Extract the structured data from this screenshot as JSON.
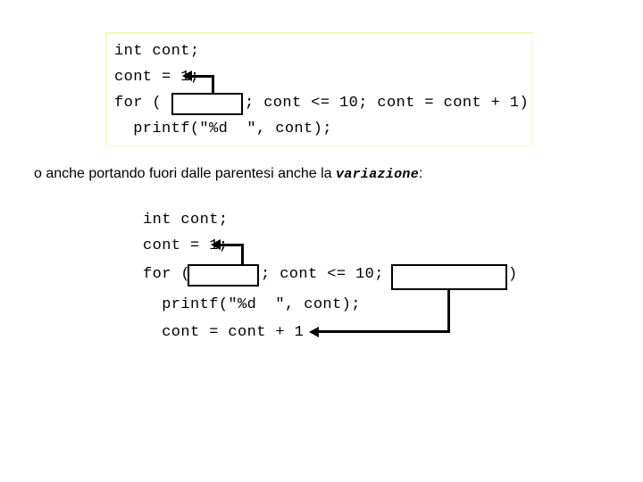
{
  "slide": {
    "background_color": "#ffffff",
    "text_color": "#000000",
    "frame_color": "#f7f7c8"
  },
  "snippet_one": {
    "frame_visible": true,
    "lines": [
      {
        "id": "l1",
        "text": "int cont;"
      },
      {
        "id": "l2",
        "text": "cont = 1;"
      },
      {
        "id": "l3a",
        "text": "for ("
      },
      {
        "id": "l3b",
        "text": "; cont <= 10; cont = cont + 1)"
      },
      {
        "id": "l4",
        "text": "  printf(\"%d  \", cont);"
      }
    ],
    "blank_box": {
      "name": "initialization-blank",
      "value": "",
      "placeholder": ""
    },
    "connector": {
      "name": "initialization-connector",
      "label": "arrow from blank init box to cont = 1;"
    }
  },
  "caption": {
    "text_before": "o anche portando fuori dalle parentesi anche la ",
    "emphasis": "variazione",
    "text_after": ":"
  },
  "snippet_two": {
    "frame_visible": false,
    "lines": [
      {
        "id": "l1",
        "text": "int cont;"
      },
      {
        "id": "l2",
        "text": "cont = 1;"
      },
      {
        "id": "l3a",
        "text": "for ("
      },
      {
        "id": "l3b",
        "text": "; cont <= 10;"
      },
      {
        "id": "l3c",
        "text": ")"
      },
      {
        "id": "l4",
        "text": "  printf(\"%d  \", cont);"
      },
      {
        "id": "l5",
        "text": "  cont = cont + 1"
      }
    ],
    "blank_box_init": {
      "name": "initialization-blank",
      "value": "",
      "placeholder": ""
    },
    "blank_box_update": {
      "name": "update-blank",
      "value": "",
      "placeholder": ""
    },
    "connector_init": {
      "name": "initialization-connector",
      "label": "arrow from blank init box to cont = 1;"
    },
    "connector_update": {
      "name": "update-connector",
      "label": "arrow from blank update box to cont = cont + 1"
    }
  }
}
